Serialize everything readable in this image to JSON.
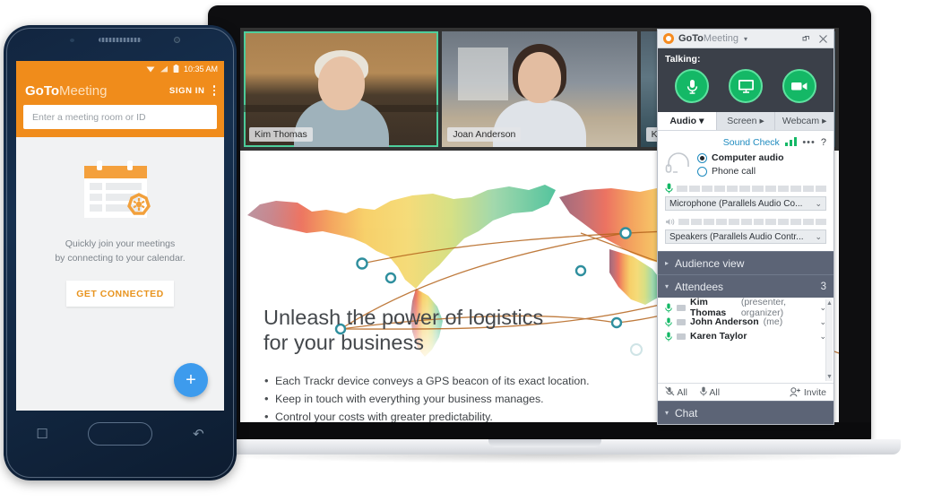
{
  "phone": {
    "status_bar": {
      "time": "10:35 AM",
      "icons": [
        "wifi-icon",
        "signal-icon",
        "battery-icon"
      ]
    },
    "brand_bold": "GoTo",
    "brand_light": "Meeting",
    "sign_in": "SIGN IN",
    "menu_icon": "kebab-menu-icon",
    "search_placeholder": "Enter a meeting room or ID",
    "search_value": "",
    "promo_line1": "Quickly join your meetings",
    "promo_line2": "by connecting to your calendar.",
    "cta": "GET CONNECTED",
    "fab_icon": "plus-icon",
    "nav": {
      "recents": "recents-icon",
      "home": "home-button",
      "back": "back-icon"
    },
    "accent": "#f08c1b",
    "fab_color": "#3d9bed"
  },
  "meeting": {
    "videos": [
      {
        "name": "Kim Thomas",
        "active": true
      },
      {
        "name": "Joan Anderson",
        "active": false
      },
      {
        "name": "Karen Taylor",
        "active": false
      }
    ],
    "slide": {
      "title_line1": "Unleash the power of logistics",
      "title_line2": "for your business",
      "bullets": [
        "Each Trackr device conveys a GPS beacon of its exact location.",
        "Keep in touch with everything your business manages.",
        "Control your costs with greater predictability."
      ]
    }
  },
  "panel": {
    "title_bold": "GoTo",
    "title_light": "Meeting",
    "title_caret": "▾",
    "restore_icon": "restore-window-icon",
    "close_icon": "close-icon",
    "talking_label": "Talking:",
    "controls": [
      {
        "name": "microphone-toggle",
        "icon": "microphone-icon"
      },
      {
        "name": "screen-share-toggle",
        "icon": "monitor-icon"
      },
      {
        "name": "webcam-toggle",
        "icon": "camera-icon"
      }
    ],
    "tabs": [
      {
        "label": "Audio",
        "marker": "▾",
        "active": true
      },
      {
        "label": "Screen",
        "marker": "▸",
        "active": false
      },
      {
        "label": "Webcam",
        "marker": "▸",
        "active": false
      }
    ],
    "sound_check": "Sound Check",
    "more_icon": "•••",
    "help_icon": "?",
    "audio_modes": [
      {
        "label": "Computer audio",
        "selected": true
      },
      {
        "label": "Phone call",
        "selected": false
      }
    ],
    "mic_device": "Microphone (Parallels Audio Co...",
    "speaker_device": "Speakers (Parallels Audio Contr...",
    "mic_icon": "microphone-icon",
    "speaker_icon": "speaker-icon",
    "chevron": "⌄",
    "sections": {
      "audience_view": {
        "label": "Audience view",
        "expanded": false,
        "marker": "▸"
      },
      "attendees": {
        "label": "Attendees",
        "expanded": true,
        "marker": "▾",
        "count": "3"
      },
      "chat": {
        "label": "Chat",
        "expanded": true,
        "marker": "▾"
      }
    },
    "attendees": [
      {
        "name": "Kim Thomas",
        "role": "(presenter, organizer)"
      },
      {
        "name": "John Anderson",
        "role": "(me)"
      },
      {
        "name": "Karen Taylor",
        "role": ""
      }
    ],
    "tools": {
      "mute_all": "All",
      "mute_all_icon": "mic-muted-icon",
      "unmute_all": "All",
      "unmute_all_icon": "microphone-icon",
      "invite": "Invite",
      "invite_icon": "add-person-icon"
    },
    "accent_green": "#14b866",
    "section_bg": "#5c6476"
  }
}
